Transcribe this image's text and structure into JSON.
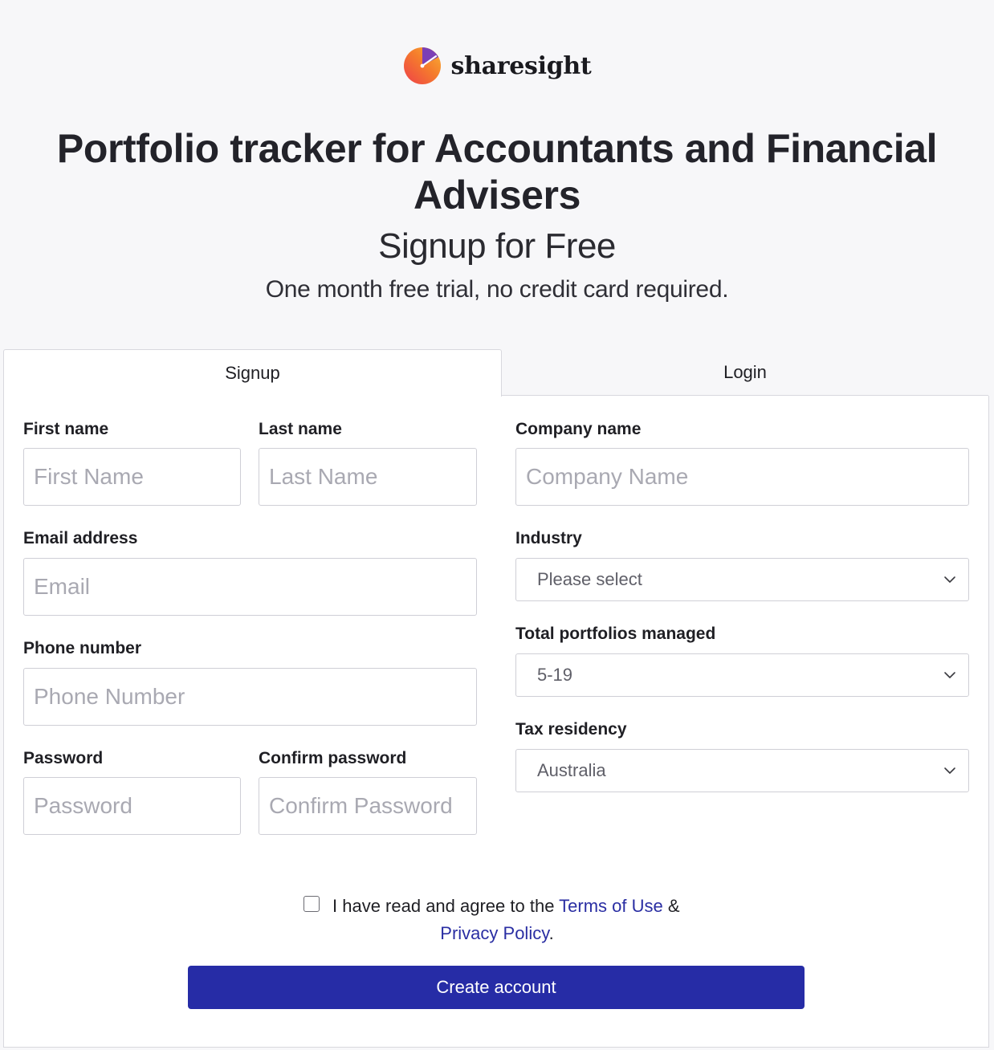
{
  "brand": {
    "name": "sharesight",
    "colors": {
      "logo_gradient_start": "#f0503a",
      "logo_gradient_end": "#f7b733",
      "logo_accent": "#7b3fb6"
    }
  },
  "header": {
    "headline": "Portfolio tracker for Accountants and Financial Advisers",
    "subhead": "Signup for Free",
    "tagline": "One month free trial, no credit card required."
  },
  "tabs": [
    {
      "label": "Signup",
      "active": true
    },
    {
      "label": "Login",
      "active": false
    }
  ],
  "form": {
    "first_name": {
      "label": "First name",
      "placeholder": "First Name",
      "value": ""
    },
    "last_name": {
      "label": "Last name",
      "placeholder": "Last Name",
      "value": ""
    },
    "email": {
      "label": "Email address",
      "placeholder": "Email",
      "value": ""
    },
    "phone": {
      "label": "Phone number",
      "placeholder": "Phone Number",
      "value": ""
    },
    "password": {
      "label": "Password",
      "placeholder": "Password",
      "value": ""
    },
    "confirm_password": {
      "label": "Confirm password",
      "placeholder": "Confirm Password",
      "value": ""
    },
    "company": {
      "label": "Company name",
      "placeholder": "Company Name",
      "value": ""
    },
    "industry": {
      "label": "Industry",
      "selected": "Please select",
      "icon": "chevron-down-icon"
    },
    "portfolios": {
      "label": "Total portfolios managed",
      "selected": "5-19",
      "icon": "chevron-down-icon"
    },
    "tax_residency": {
      "label": "Tax residency",
      "selected": "Australia",
      "icon": "chevron-down-icon"
    }
  },
  "agreement": {
    "checked": false,
    "prefix": "I have read and agree to the",
    "terms_link": "Terms of Use",
    "connector": "&",
    "privacy_link": "Privacy Policy",
    "suffix": "."
  },
  "submit": {
    "label": "Create account",
    "color": "#262ca6"
  }
}
